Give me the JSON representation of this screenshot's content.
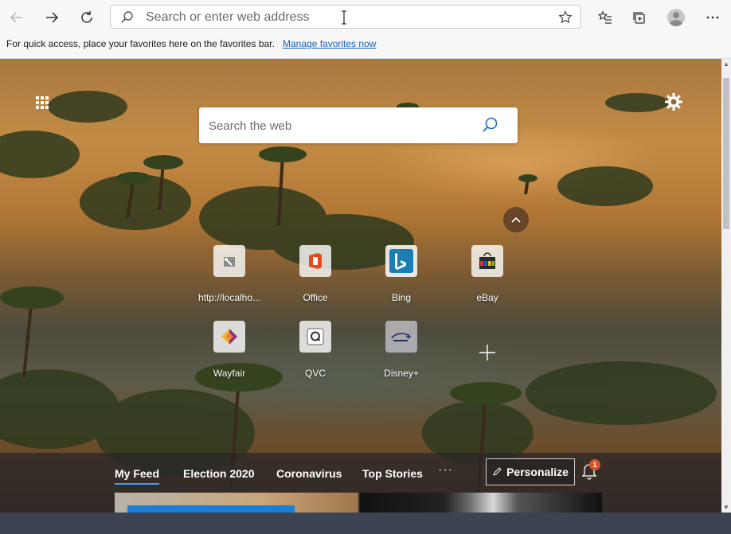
{
  "browser": {
    "address_placeholder": "Search or enter web address"
  },
  "favorites_bar": {
    "message": "For quick access, place your favorites here on the favorites bar.",
    "manage_link": "Manage favorites now"
  },
  "newtab": {
    "search_placeholder": "Search the web",
    "tiles": [
      {
        "label": "http://localho...",
        "icon": "localhost-icon"
      },
      {
        "label": "Office",
        "icon": "office-icon"
      },
      {
        "label": "Bing",
        "icon": "bing-icon"
      },
      {
        "label": "eBay",
        "icon": "ebay-icon"
      },
      {
        "label": "Wayfair",
        "icon": "wayfair-icon"
      },
      {
        "label": "QVC",
        "icon": "qvc-icon"
      },
      {
        "label": "Disney+",
        "icon": "disney-plus-icon"
      }
    ]
  },
  "feed": {
    "tabs": [
      "My Feed",
      "Election 2020",
      "Coronavirus",
      "Top Stories"
    ],
    "active_tab": "My Feed",
    "more": "···",
    "personalize_label": "Personalize",
    "notification_count": "1"
  },
  "colors": {
    "accent_link": "#1a5fb4",
    "feed_underline": "#3aa0ff",
    "badge": "#d9532a"
  }
}
